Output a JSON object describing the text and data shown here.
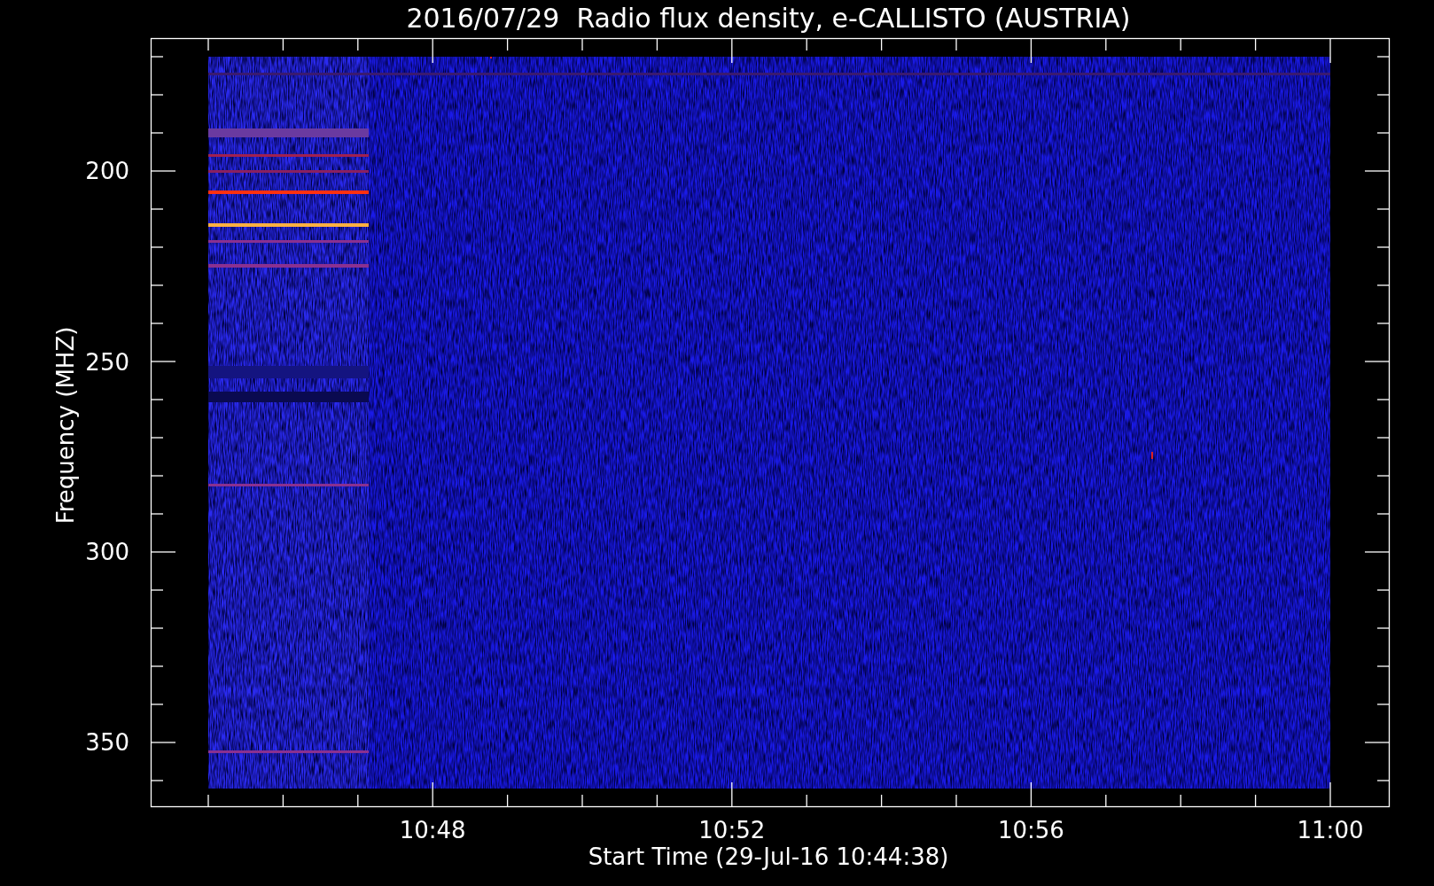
{
  "plot": {
    "title": "2016/07/29  Radio flux density, e-CALLISTO (AUSTRIA)",
    "ylabel": "Frequency (MHZ)",
    "xlabel": "Start Time (29-Jul-16 10:44:38)",
    "yticks": [
      "200",
      "250",
      "300",
      "350"
    ],
    "xticks": [
      "10:48",
      "10:52",
      "10:56",
      "11:00"
    ]
  }
}
